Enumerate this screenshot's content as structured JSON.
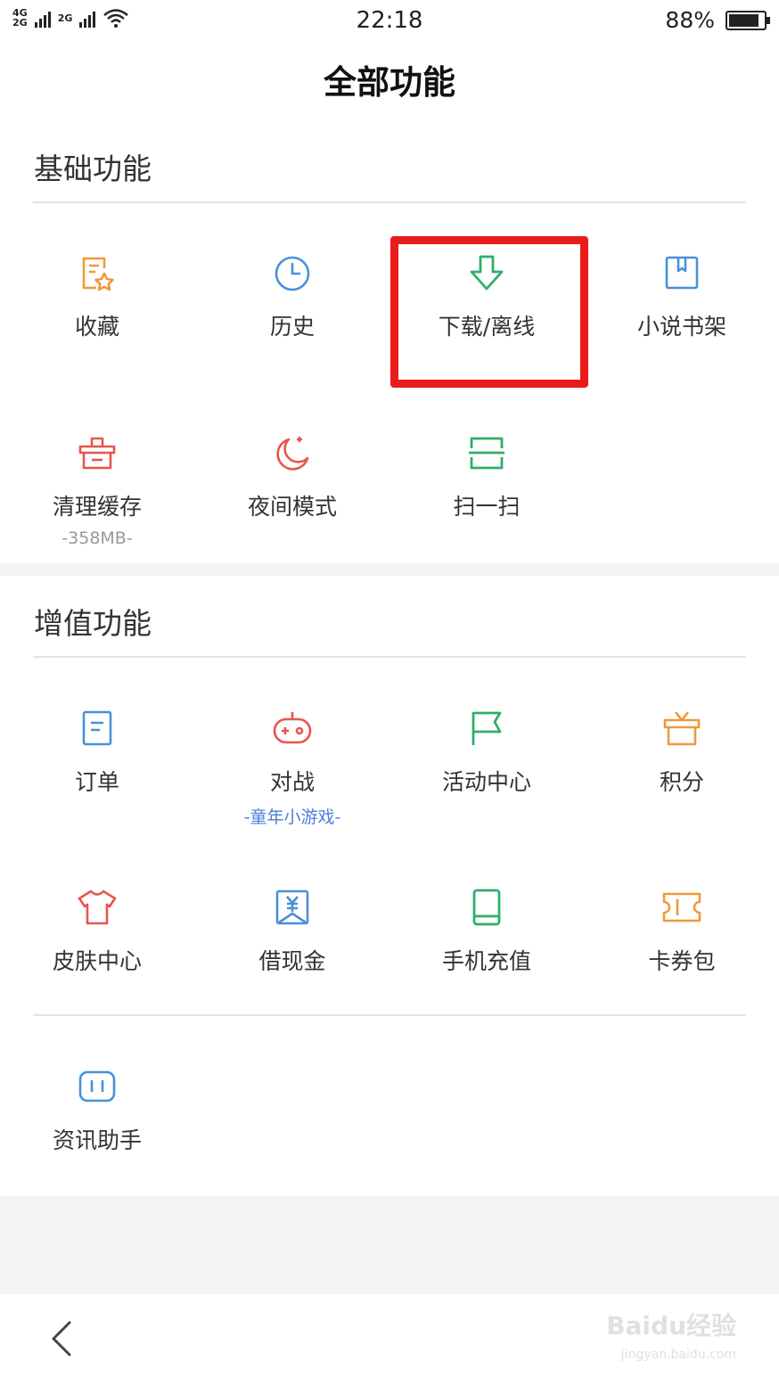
{
  "status_bar": {
    "network_primary": "4G",
    "network_secondary": "2G",
    "network_sim2": "2G",
    "time": "22:18",
    "battery_percent_label": "88%",
    "battery_level": 0.88
  },
  "page_title": "全部功能",
  "sections": {
    "basic": {
      "title": "基础功能",
      "items": [
        {
          "label": "收藏",
          "icon": "favorites-icon",
          "color": "#f0993a"
        },
        {
          "label": "历史",
          "icon": "clock-icon",
          "color": "#4a90d9"
        },
        {
          "label": "下载/离线",
          "icon": "download-arrow-icon",
          "color": "#2eaf6a"
        },
        {
          "label": "小说书架",
          "icon": "bookshelf-icon",
          "color": "#4a90d9"
        },
        {
          "label": "清理缓存",
          "sublabel": "-358MB-",
          "icon": "basket-icon",
          "color": "#e8554f"
        },
        {
          "label": "夜间模式",
          "icon": "moon-icon",
          "color": "#e8554f"
        },
        {
          "label": "扫一扫",
          "icon": "scan-icon",
          "color": "#2eaf6a"
        }
      ]
    },
    "premium": {
      "title": "增值功能",
      "items": [
        {
          "label": "订单",
          "icon": "order-document-icon",
          "color": "#4a90d9"
        },
        {
          "label": "对战",
          "sublabel": "-童年小游戏-",
          "icon": "gamepad-icon",
          "color": "#e8554f"
        },
        {
          "label": "活动中心",
          "icon": "flag-icon",
          "color": "#2eaf6a"
        },
        {
          "label": "积分",
          "icon": "gift-box-icon",
          "color": "#f0993a"
        },
        {
          "label": "皮肤中心",
          "icon": "tshirt-icon",
          "color": "#e8554f"
        },
        {
          "label": "借现金",
          "icon": "cash-yen-icon",
          "color": "#4a90d9"
        },
        {
          "label": "手机充值",
          "icon": "phone-book-icon",
          "color": "#2eaf6a"
        },
        {
          "label": "卡券包",
          "icon": "ticket-icon",
          "color": "#f0993a"
        },
        {
          "label": "资讯助手",
          "icon": "tv-assistant-icon",
          "color": "#4a90d9"
        }
      ]
    }
  },
  "colors": {
    "sublabel_gray": "#999999",
    "sublabel_blue": "#4a7fd9",
    "highlight_red": "#ea1b1b"
  },
  "watermark": {
    "logo_text": "Baidu经验",
    "url_text": "jingyan.baidu.com"
  }
}
